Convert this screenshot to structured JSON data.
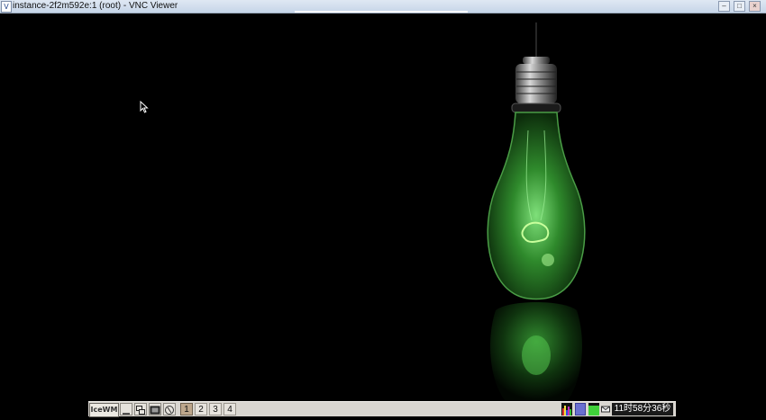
{
  "window": {
    "title": "instance-2f2m592e:1 (root) - VNC Viewer",
    "icon": "vnc-icon"
  },
  "taskbar": {
    "start_label": "IceWM",
    "workspaces": [
      "1",
      "2",
      "3",
      "4"
    ],
    "active_workspace": "1",
    "clock": "11时58分36秒",
    "tray_icons": [
      "cpu-monitor-icon",
      "network-icon",
      "memory-icon",
      "mail-icon"
    ]
  },
  "wallpaper": {
    "subject": "green-light-bulb",
    "accent_color": "#3fbf3a"
  }
}
